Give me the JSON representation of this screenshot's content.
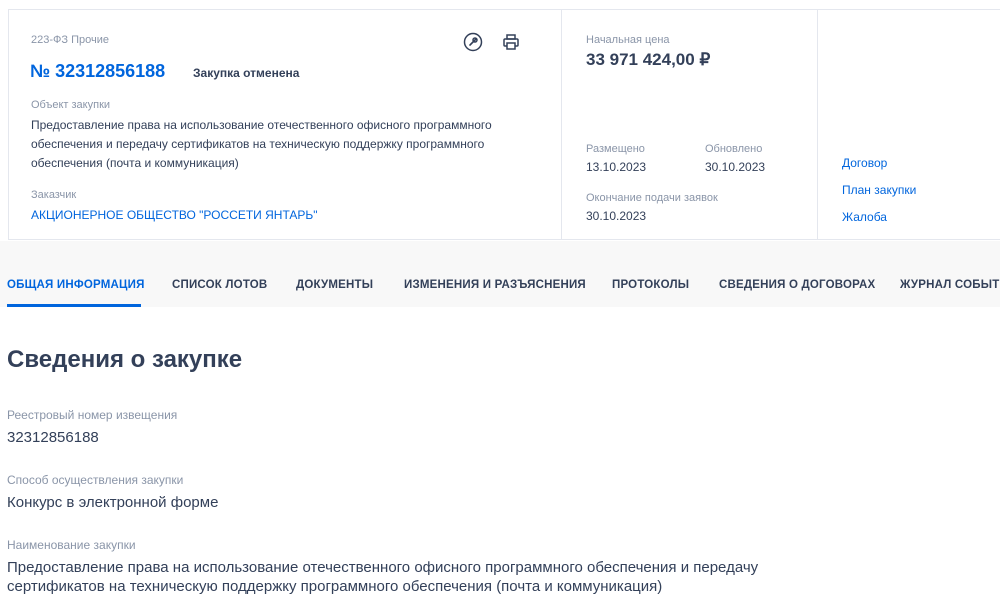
{
  "header": {
    "procedure_type": "223-ФЗ Прочие",
    "number": "№ 32312856188",
    "status": "Закупка отменена",
    "object_label": "Объект закупки",
    "object_text": "Предоставление права на использование отечественного офисного программного обеспечения и передачу сертификатов на техническую поддержку программного обеспечения (почта и коммуникация)",
    "customer_label": "Заказчик",
    "customer_name": "АКЦИОНЕРНОЕ ОБЩЕСТВО \"РОССЕТИ ЯНТАРЬ\"",
    "icons": [
      "link-icon",
      "print-icon"
    ]
  },
  "price": {
    "label": "Начальная цена",
    "value": "33 971 424,00 ₽"
  },
  "dates": {
    "posted_label": "Размещено",
    "posted_value": "13.10.2023",
    "updated_label": "Обновлено",
    "updated_value": "30.10.2023",
    "deadline_label": "Окончание подачи заявок",
    "deadline_value": "30.10.2023"
  },
  "links": {
    "contract": "Договор",
    "plan": "План закупки",
    "complaint": "Жалоба"
  },
  "tabs": [
    "ОБЩАЯ ИНФОРМАЦИЯ",
    "СПИСОК ЛОТОВ",
    "ДОКУМЕНТЫ",
    "ИЗМЕНЕНИЯ И РАЗЪЯСНЕНИЯ",
    "ПРОТОКОЛЫ",
    "СВЕДЕНИЯ О ДОГОВОРАХ",
    "ЖУРНАЛ СОБЫТИЙ"
  ],
  "section": {
    "title": "Сведения о закупке",
    "fields": [
      {
        "label": "Реестровый номер извещения",
        "value": "32312856188"
      },
      {
        "label": "Способ осуществления закупки",
        "value": "Конкурс в электронной форме"
      },
      {
        "label": "Наименование закупки",
        "value": "Предоставление права на использование отечественного офисного программного обеспечения и передачу сертификатов на техническую поддержку программного обеспечения (почта и коммуникация)"
      }
    ]
  },
  "colors": {
    "accent": "#0065dd",
    "text": "#334059",
    "muted": "#8a95a8",
    "tabs_bg": "#f8f8f8"
  }
}
